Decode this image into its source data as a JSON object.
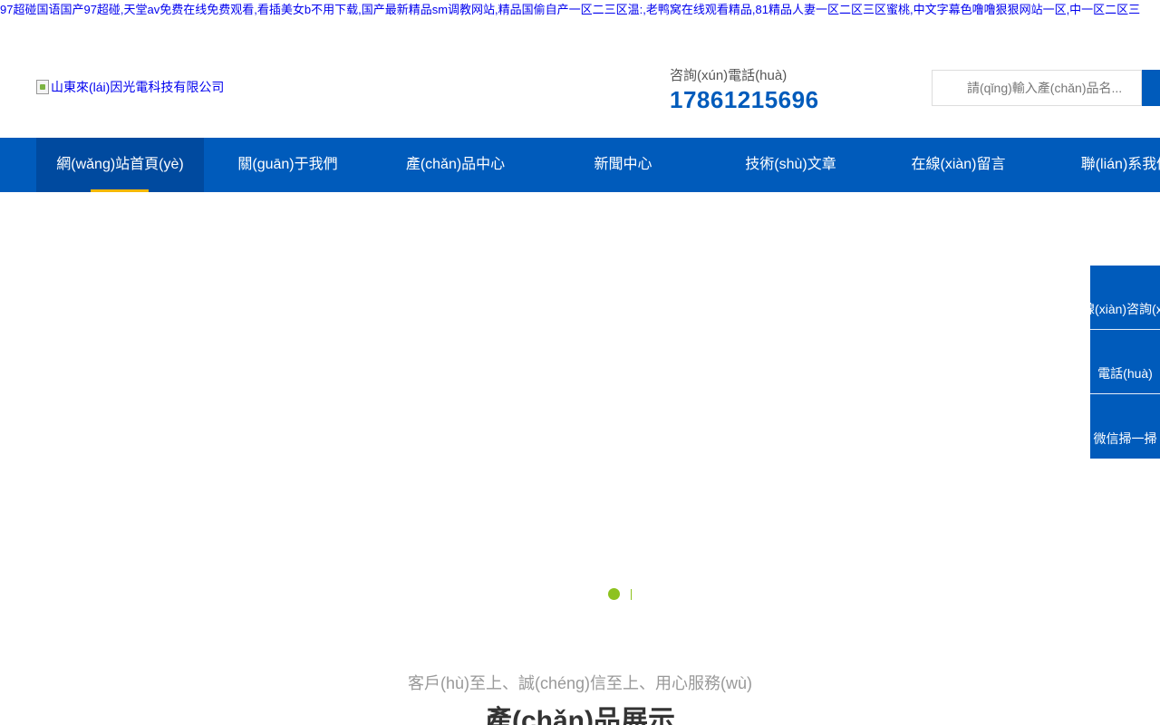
{
  "top_links": "97超碰国语国产97超碰,天堂av免费在线免费观看,看插美女b不用下载,国产最新精品sm调教网站,精品国偷自产一区二三区温:,老鸭窝在线观看精品,81精品人妻一区二区三区蜜桃,中文字幕色噜噜狠狠网站一区,中一区二区三",
  "header": {
    "logo_alt": "山東來(lái)因光電科技有限公司",
    "hotline_label": "咨詢(xún)電話(huà)",
    "hotline_number": "17861215696",
    "search_placeholder": "請(qǐng)輸入產(chǎn)品名..."
  },
  "nav": {
    "items": [
      {
        "label": "網(wǎng)站首頁(yè)",
        "active": true
      },
      {
        "label": "關(guān)于我們"
      },
      {
        "label": "產(chǎn)品中心"
      },
      {
        "label": "新聞中心"
      },
      {
        "label": "技術(shù)文章"
      },
      {
        "label": "在線(xiàn)留言"
      },
      {
        "label": "聯(lián)系我們"
      }
    ]
  },
  "side_float": {
    "items": [
      "在線(xiàn)咨詢(xún)",
      "電話(huà)",
      "微信掃一掃"
    ]
  },
  "section": {
    "subtitle": "客戶(hù)至上、誠(chéng)信至上、用心服務(wù)",
    "title": "產(chǎn)品展示"
  },
  "colors": {
    "brand_blue": "#005bbb",
    "nav_active": "#004a9f",
    "accent_yellow": "#f5b800",
    "dot_green": "#8dc21f"
  }
}
